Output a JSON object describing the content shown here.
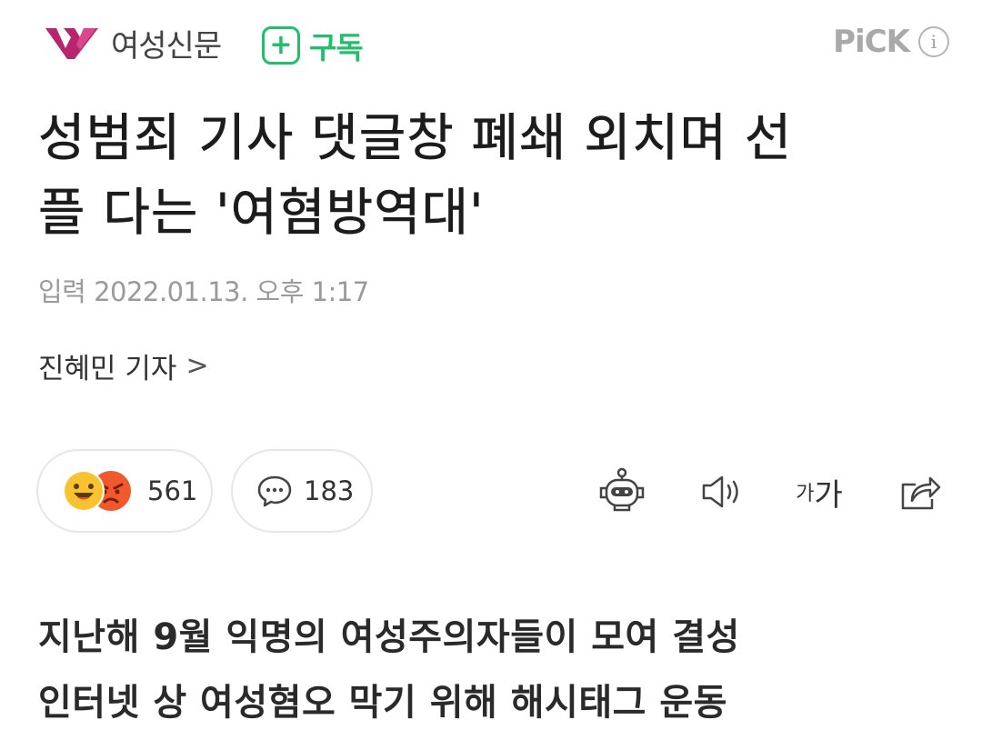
{
  "header": {
    "press_name": "여성신문",
    "subscribe_label": "구독",
    "subscribe_icon": "plus-icon",
    "pick_label": "PiCK",
    "info_icon": "info-icon",
    "accent_color": "#20c06a",
    "logo_color": "#b8256e"
  },
  "article": {
    "title_line1": "성범죄 기사 댓글창 폐쇄 외치며 선",
    "title_line2": "플 다는 '여혐방역대'",
    "date": "입력 2022.01.13. 오후 1:17",
    "reporter": "진혜민 기자",
    "reporter_chevron": ">"
  },
  "engagement": {
    "reactions_count": "561",
    "comments_count": "183",
    "reaction_icons": [
      "smile-emoji-icon",
      "angry-emoji-icon"
    ],
    "comment_icon": "speech-bubble-icon"
  },
  "toolbar": {
    "summary_icon": "robot-summary-icon",
    "audio_icon": "speaker-icon",
    "font_small": "가",
    "font_big": "가",
    "share_icon": "share-icon"
  },
  "lead": {
    "line1": "지난해 9월 익명의 여성주의자들이 모여 결성",
    "line2": "인터넷 상 여성혐오 막기 위해 해시태그 운동"
  }
}
